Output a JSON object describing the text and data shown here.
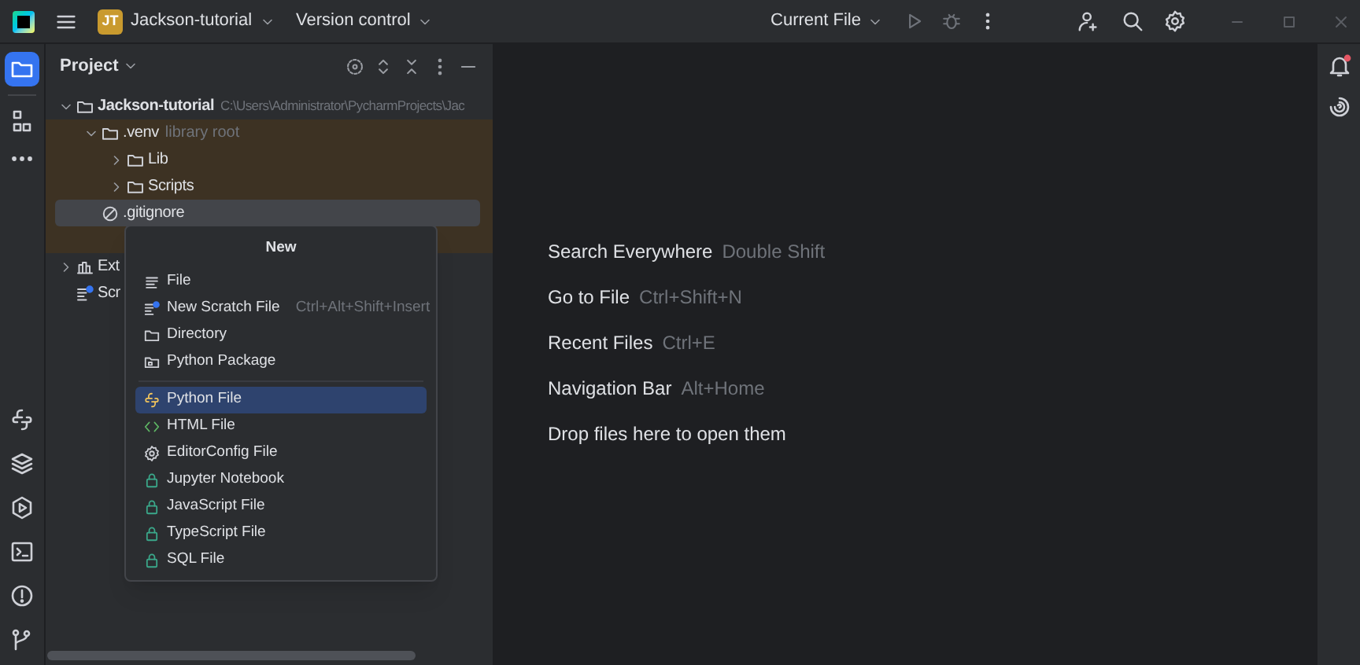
{
  "toolbar": {
    "project_badge": "JT",
    "project": "Jackson-tutorial",
    "vcs": "Version control",
    "run_config": "Current File"
  },
  "tool_strip": [
    {
      "selected": true
    },
    {
      "selected": false
    }
  ],
  "project_panel": {
    "title": "Project",
    "tree": [
      {
        "name": "Jackson-tutorial",
        "hint": "C:\\Users\\Administrator\\PycharmProjects\\Jac",
        "expanded": true,
        "selected": false,
        "excluded": false,
        "children": [
          {
            "name": ".venv",
            "hint": "library root",
            "expanded": true,
            "selected": false,
            "excluded": true,
            "children": [
              {
                "name": "Lib",
                "expanded": false,
                "selected": false,
                "excluded": true
              },
              {
                "name": "Scripts",
                "expanded": false,
                "selected": false,
                "excluded": true
              }
            ]
          },
          {
            "name": ".gitignore",
            "selected": true,
            "excluded": true
          }
        ]
      },
      {
        "name": "Ext",
        "expanded": false,
        "selected": false,
        "excluded": false
      },
      {
        "name": "Scr",
        "selected": false,
        "excluded": false
      }
    ]
  },
  "new_menu": {
    "title": "New",
    "groups": [
      [
        {
          "label": "File",
          "selected": false
        },
        {
          "label": "New Scratch File",
          "shortcut": "Ctrl+Alt+Shift+Insert",
          "selected": false
        },
        {
          "label": "Directory",
          "selected": false
        },
        {
          "label": "Python Package",
          "selected": false
        }
      ],
      [
        {
          "label": "Python File",
          "selected": true
        },
        {
          "label": "HTML File",
          "selected": false
        },
        {
          "label": "EditorConfig File",
          "selected": false
        },
        {
          "label": "Jupyter Notebook",
          "selected": false
        },
        {
          "label": "JavaScript File",
          "selected": false
        },
        {
          "label": "TypeScript File",
          "selected": false
        },
        {
          "label": "SQL File",
          "selected": false
        }
      ]
    ]
  },
  "editor_hints": [
    {
      "label": "Search Everywhere",
      "shortcut": "Double Shift"
    },
    {
      "label": "Go to File",
      "shortcut": "Ctrl+Shift+N"
    },
    {
      "label": "Recent Files",
      "shortcut": "Ctrl+E"
    },
    {
      "label": "Navigation Bar",
      "shortcut": "Alt+Home"
    },
    {
      "label": "Drop files here to open them"
    }
  ]
}
